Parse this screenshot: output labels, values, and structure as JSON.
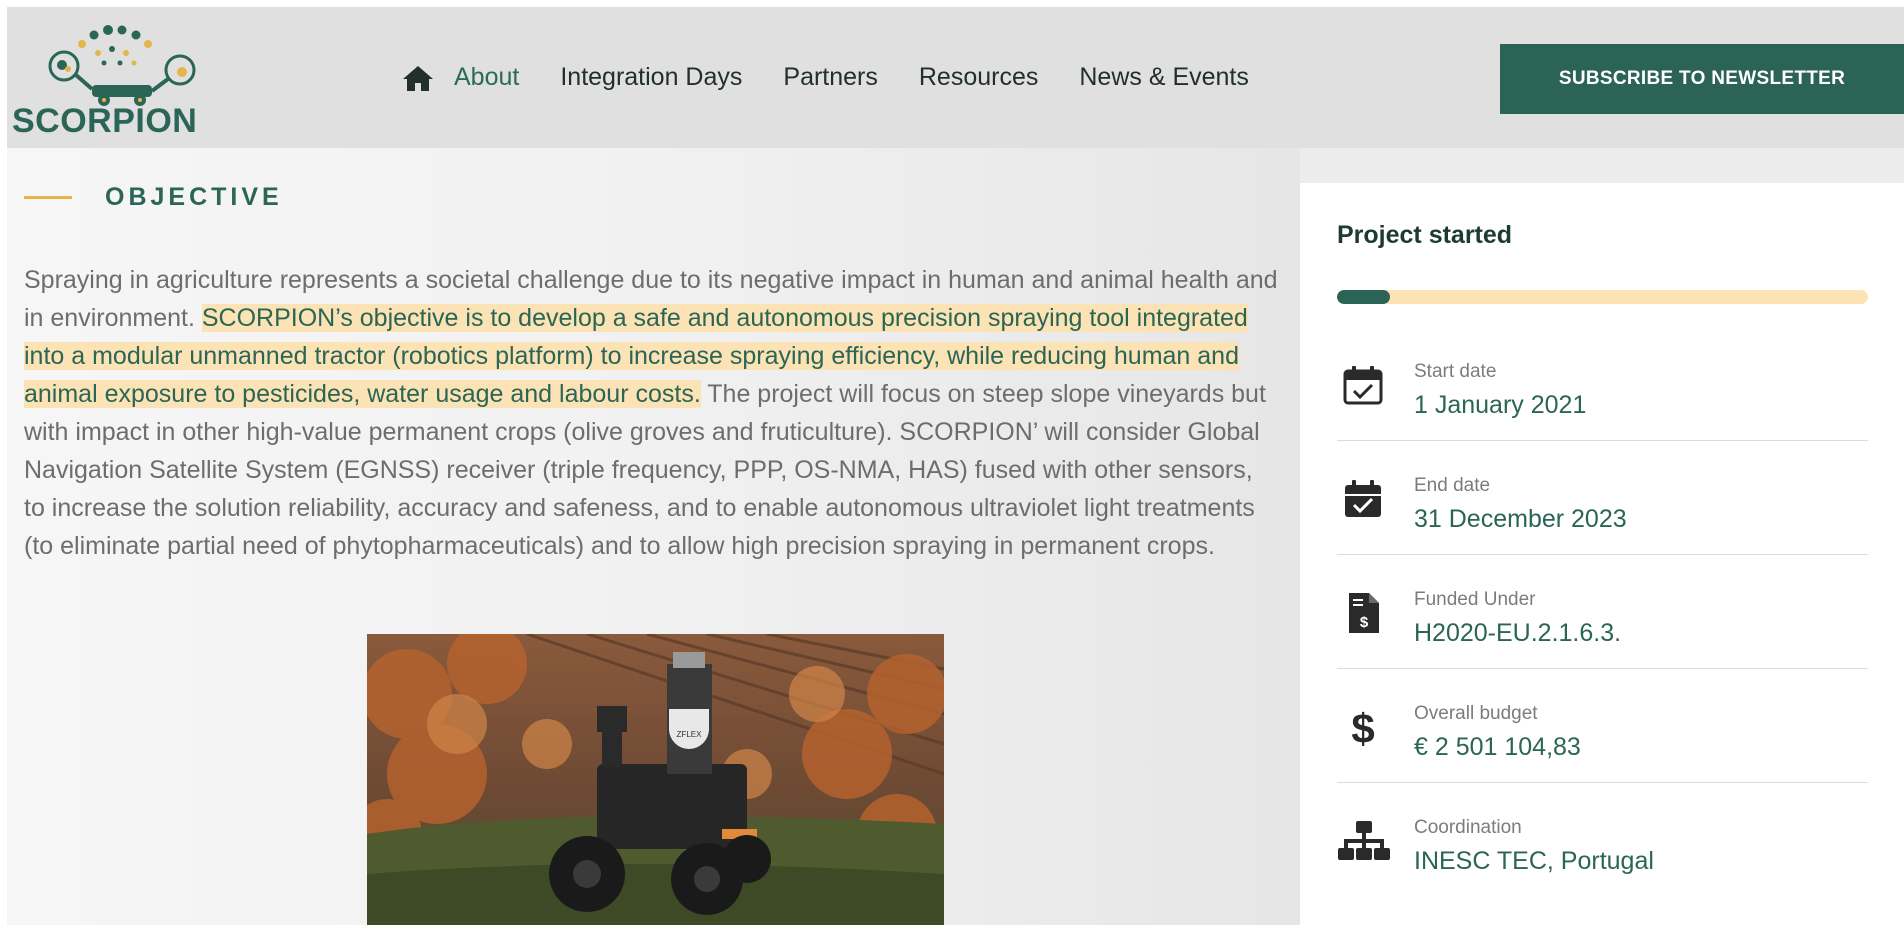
{
  "brand": {
    "name": "SCORPION",
    "colors": {
      "primary": "#2b6357",
      "accent": "#e5b54c",
      "highlight": "#fbe3b5"
    }
  },
  "nav": {
    "home_icon": "home-icon",
    "items": [
      {
        "label": "About",
        "active": true
      },
      {
        "label": "Integration Days",
        "active": false
      },
      {
        "label": "Partners",
        "active": false
      },
      {
        "label": "Resources",
        "active": false
      },
      {
        "label": "News & Events",
        "active": false
      }
    ],
    "subscribe_label": "SUBSCRIBE TO NEWSLETTER"
  },
  "objective": {
    "title": "OBJECTIVE",
    "text_before": "Spraying in agriculture represents a societal challenge due to its negative impact in human and animal health and in environment. ",
    "text_highlight": "SCORPION’s objective is to develop a safe and autonomous precision spraying tool integrated into a modular unmanned tractor (robotics platform) to increase spraying efficiency, while reducing human and animal exposure to pesticides, water usage and labour costs.",
    "text_after": " The project will focus on steep slope vineyards but with impact in other high-value permanent crops (olive groves and fruticulture). SCORPION’ will consider Global Navigation Satellite System (EGNSS) receiver (triple frequency, PPP, OS-NMA, HAS) fused with other sensors, to increase the solution reliability, accuracy and safeness, and to enable autonomous ultraviolet light treatments (to eliminate partial need of phytopharmaceuticals) and to allow high precision spraying in permanent crops.",
    "photo_label": "ZFLEX"
  },
  "sidebar": {
    "status_title": "Project started",
    "progress_fraction": 0.1,
    "rows": [
      {
        "icon": "calendar-check-icon",
        "label": "Start date",
        "value": "1 January 2021"
      },
      {
        "icon": "calendar-check-filled-icon",
        "label": "End date",
        "value": "31 December 2023"
      },
      {
        "icon": "file-invoice-dollar-icon",
        "label": "Funded Under",
        "value": "H2020-EU.2.1.6.3."
      },
      {
        "icon": "dollar-icon",
        "label": "Overall budget",
        "value": "€ 2 501 104,83"
      },
      {
        "icon": "sitemap-icon",
        "label": "Coordination",
        "value": "INESC TEC, Portugal"
      }
    ]
  }
}
